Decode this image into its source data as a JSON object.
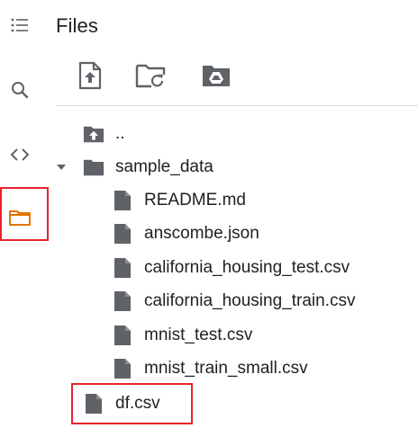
{
  "panel": {
    "title": "Files"
  },
  "rail": {
    "items": [
      {
        "name": "table-of-contents",
        "icon": "list-icon"
      },
      {
        "name": "search",
        "icon": "search-icon"
      },
      {
        "name": "code-snippets",
        "icon": "code-icon"
      },
      {
        "name": "files",
        "icon": "folder-icon",
        "active": true
      }
    ]
  },
  "toolbar": {
    "buttons": [
      {
        "name": "upload",
        "icon": "upload-file-icon"
      },
      {
        "name": "refresh",
        "icon": "folder-refresh-icon"
      },
      {
        "name": "mount-drive",
        "icon": "drive-folder-icon"
      }
    ]
  },
  "tree": {
    "parent": {
      "label": ".."
    },
    "folder": {
      "label": "sample_data",
      "expanded": true,
      "files": [
        {
          "label": "README.md"
        },
        {
          "label": "anscombe.json"
        },
        {
          "label": "california_housing_test.csv"
        },
        {
          "label": "california_housing_train.csv"
        },
        {
          "label": "mnist_test.csv"
        },
        {
          "label": "mnist_train_small.csv"
        }
      ]
    },
    "root_files": [
      {
        "label": "df.csv"
      }
    ]
  },
  "colors": {
    "icon_gray": "#5f6368",
    "active_orange": "#e37400",
    "highlight_red": "#e8222a",
    "text": "#202124"
  }
}
